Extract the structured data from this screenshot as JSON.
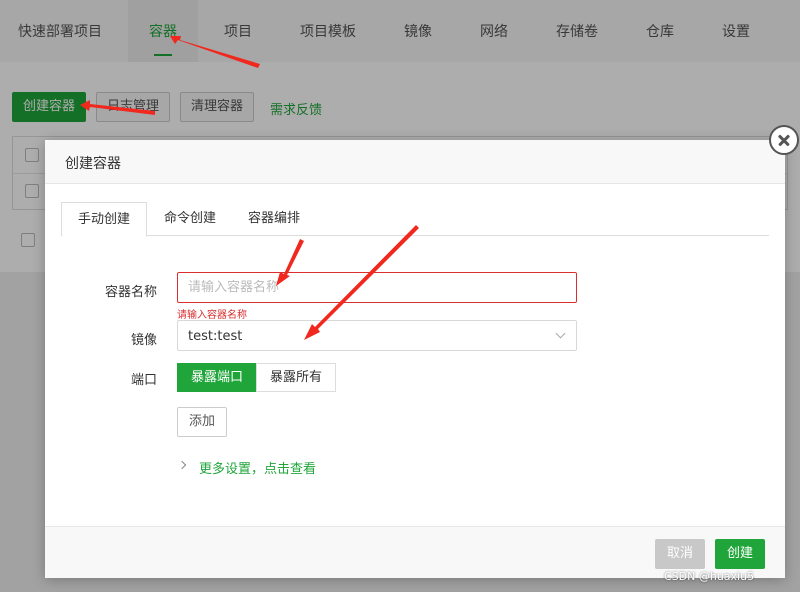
{
  "nav": {
    "items": [
      {
        "label": "快速部署项目"
      },
      {
        "label": "容器"
      },
      {
        "label": "项目"
      },
      {
        "label": "项目模板"
      },
      {
        "label": "镜像"
      },
      {
        "label": "网络"
      },
      {
        "label": "存储卷"
      },
      {
        "label": "仓库"
      },
      {
        "label": "设置"
      }
    ],
    "active": "容器"
  },
  "toolbar": {
    "create_container": "创建容器",
    "log_manage": "日志管理",
    "clean_container": "清理容器",
    "feedback": "需求反馈"
  },
  "modal": {
    "title": "创建容器",
    "tabs": [
      {
        "label": "手动创建"
      },
      {
        "label": "命令创建"
      },
      {
        "label": "容器编排"
      }
    ],
    "form": {
      "name_label": "容器名称",
      "name_placeholder": "请输入容器名称",
      "name_value": "",
      "name_error": "请输入容器名称",
      "image_label": "镜像",
      "image_value": "test:test",
      "port_label": "端口",
      "port_expose": "暴露端口",
      "port_expose_all": "暴露所有",
      "add": "添加",
      "more_settings": "更多设置，点击查看"
    },
    "footer": {
      "cancel": "取消",
      "create": "创建"
    }
  },
  "watermark": "CSDN @huaxiu5",
  "colors": {
    "accent": "#20a53a",
    "error": "#d9302f",
    "arrow": "#f0281e"
  }
}
